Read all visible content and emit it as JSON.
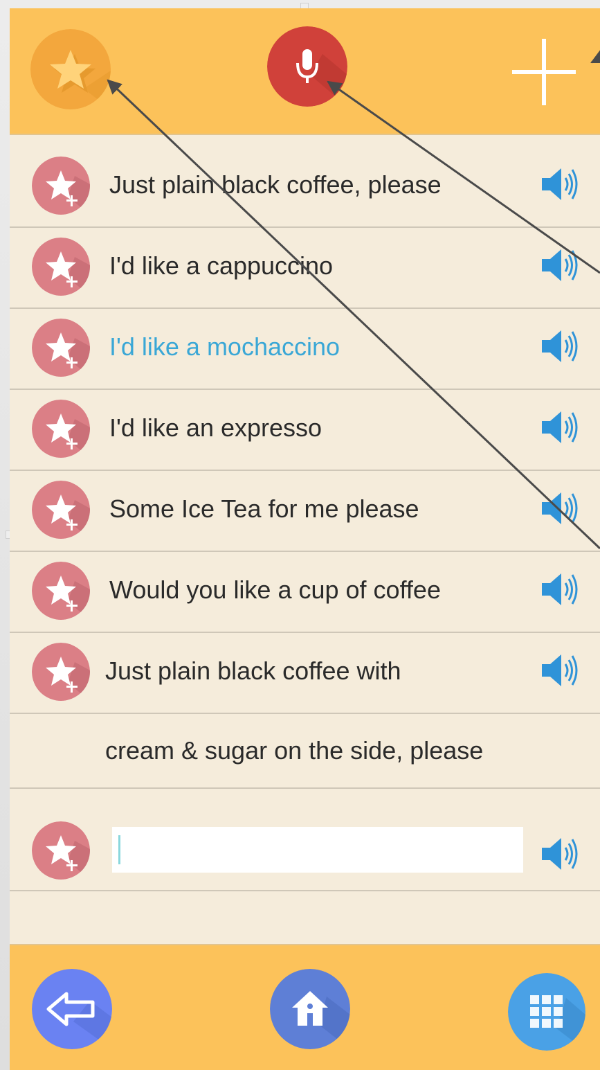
{
  "colors": {
    "bar": "#fcc25a",
    "background": "#f5ecdb",
    "favorite_button": "#f3a73d",
    "mic_button": "#d0413a",
    "row_star": "#db7f86",
    "speaker": "#2f93d8",
    "back_button": "#6a82f2",
    "home_button": "#5e7fd6",
    "grid_button": "#4aa1e6",
    "active_text": "#3aa7d6"
  },
  "topbar": {
    "favorites_icon": "star-icon",
    "mic_icon": "microphone-icon",
    "add_icon": "plus-icon"
  },
  "phrases": [
    {
      "text": "Just plain black coffee, please",
      "active": false
    },
    {
      "text": "I'd like a cappuccino",
      "active": false
    },
    {
      "text": "I'd like a mochaccino",
      "active": true
    },
    {
      "text": "I'd like an expresso",
      "active": false
    },
    {
      "text": "Some Ice Tea for me please",
      "active": false
    },
    {
      "text": "Would you like a cup of coffee",
      "active": false
    },
    {
      "text": "Just plain black coffee with",
      "active": false,
      "continuation": "cream & sugar on the side, please"
    }
  ],
  "new_phrase": {
    "value": "",
    "placeholder": ""
  },
  "bottombar": {
    "back_icon": "back-arrow-icon",
    "home_icon": "home-icon",
    "grid_icon": "grid-icon"
  }
}
